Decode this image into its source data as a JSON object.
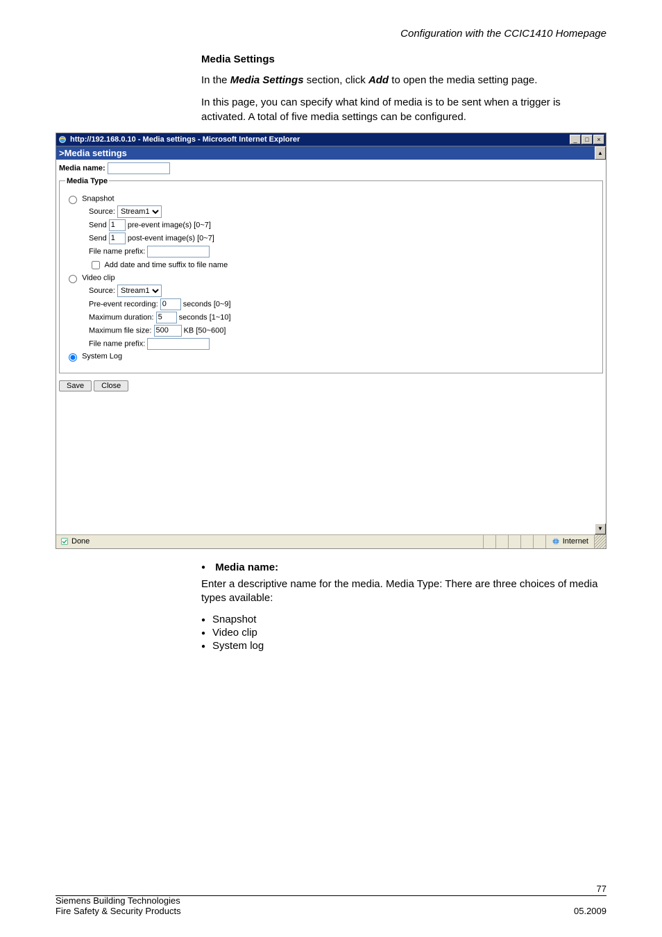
{
  "header": {
    "right": "Configuration with the CCIC1410 Homepage"
  },
  "section": {
    "title": "Media Settings",
    "para1_a": "In the ",
    "para1_b": "Media Settings",
    "para1_c": " section, click ",
    "para1_d": "Add",
    "para1_e": " to open the media setting page.",
    "para2": "In this page, you can specify what kind of media is to be sent when a trigger is activated. A total of five media settings can be configured."
  },
  "ie": {
    "title": "http://192.168.0.10 - Media settings - Microsoft Internet Explorer",
    "blueband": ">Media settings",
    "media_name_label": "Media name:",
    "media_name_value": "",
    "fieldset_legend": "Media Type",
    "snapshot": {
      "label": "Snapshot",
      "source_label": "Source:",
      "source_value": "Stream1",
      "send_label": "Send",
      "pre_value": "1",
      "pre_suffix": "pre-event image(s) [0~7]",
      "post_value": "1",
      "post_suffix": "post-event image(s) [0~7]",
      "prefix_label": "File name prefix:",
      "prefix_value": "",
      "add_dt_label": "Add date and time suffix to file name"
    },
    "video": {
      "label": "Video clip",
      "source_label": "Source:",
      "source_value": "Stream1",
      "prerec_label": "Pre-event recording:",
      "prerec_value": "0",
      "prerec_suffix": "seconds [0~9]",
      "maxdur_label": "Maximum duration:",
      "maxdur_value": "5",
      "maxdur_suffix": "seconds [1~10]",
      "maxsize_label": "Maximum file size:",
      "maxsize_value": "500",
      "maxsize_suffix": "KB [50~600]",
      "prefix_label": "File name prefix:",
      "prefix_value": ""
    },
    "syslog_label": "System Log",
    "buttons": {
      "save": "Save",
      "close": "Close"
    },
    "status": {
      "done": "Done",
      "zone": "Internet"
    }
  },
  "below": {
    "heading": "Media name:",
    "para": "Enter a descriptive name for the media. Media Type: There are three choices of media types available:",
    "items": [
      "Snapshot",
      "Video clip",
      "System log"
    ]
  },
  "footer": {
    "page": "77",
    "left1": "Siemens Building Technologies",
    "left2": "Fire Safety & Security Products",
    "right2": "05.2009"
  }
}
